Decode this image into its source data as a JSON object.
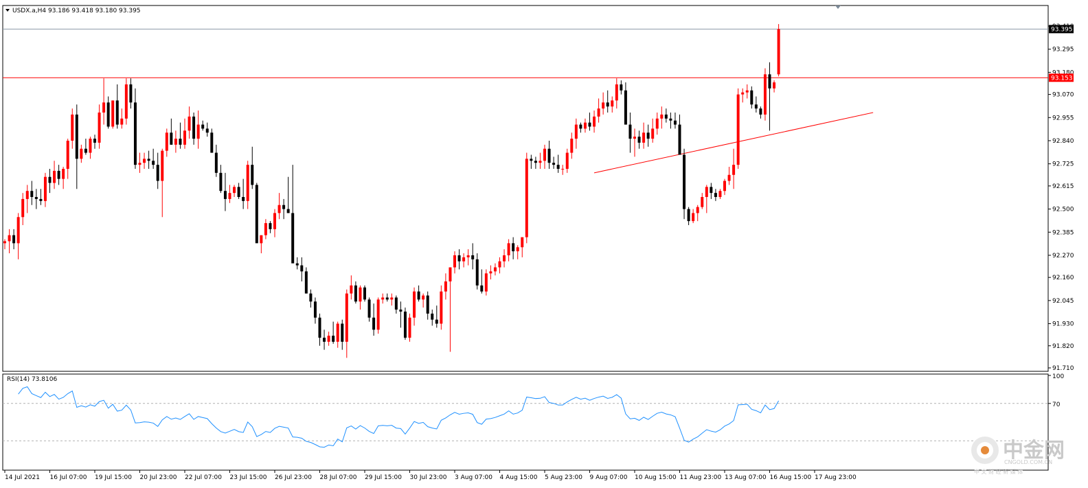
{
  "chart_header": {
    "symbol_line": "USDX.a,H4  93.186 93.418 93.180 93.395",
    "rsi_label": "RSI(14) 73.8106"
  },
  "watermark": {
    "brand": "中金网",
    "domain": "CNGOLD.COM.CN",
    "tagline": "中 文 财 经 新 媒 体"
  },
  "colors": {
    "bull": "#ff0000",
    "bear": "#000000",
    "rsi_line": "#1e90ff",
    "resistance": "#ff0000",
    "current_price_line": "#8c9aa8",
    "trendline": "#ff0000"
  },
  "chart_data": [
    {
      "type": "candlestick",
      "symbol": "USDX.a",
      "timeframe": "H4",
      "ohlc_header": {
        "open": 93.186,
        "high": 93.418,
        "low": 93.18,
        "close": 93.395
      },
      "ylim": [
        91.71,
        93.41
      ],
      "y_ticks": [
        "93.410",
        "93.295",
        "93.180",
        "93.070",
        "92.955",
        "92.840",
        "92.725",
        "92.615",
        "92.500",
        "92.385",
        "92.270",
        "92.160",
        "92.045",
        "91.930",
        "91.820",
        "91.710"
      ],
      "x_tick_labels": [
        "14 Jul 2021",
        "16 Jul 07:00",
        "19 Jul 15:00",
        "20 Jul 23:00",
        "22 Jul 07:00",
        "23 Jul 15:00",
        "26 Jul 23:00",
        "28 Jul 07:00",
        "29 Jul 15:00",
        "30 Jul 23:00",
        "3 Aug 07:00",
        "4 Aug 15:00",
        "5 Aug 23:00",
        "9 Aug 07:00",
        "10 Aug 15:00",
        "11 Aug 23:00",
        "13 Aug 07:00",
        "16 Aug 15:00",
        "17 Aug 23:00"
      ],
      "x_tick_index": [
        0,
        10,
        20,
        30,
        40,
        50,
        60,
        70,
        80,
        90,
        100,
        110,
        120,
        130,
        140,
        150,
        160,
        170,
        180
      ],
      "horizontal_lines": [
        {
          "price": 93.395,
          "label": "93.395",
          "role": "current"
        },
        {
          "price": 93.153,
          "label": "93.153",
          "role": "resistance"
        }
      ],
      "trendline": {
        "from": {
          "index": 131,
          "price": 92.68
        },
        "to": {
          "index": 193,
          "price": 92.98
        }
      },
      "candles": [
        [
          92.33,
          92.35,
          92.3,
          92.34
        ],
        [
          92.34,
          92.4,
          92.28,
          92.37
        ],
        [
          92.37,
          92.4,
          92.3,
          92.33
        ],
        [
          92.33,
          92.48,
          92.25,
          92.46
        ],
        [
          92.46,
          92.58,
          92.42,
          92.55
        ],
        [
          92.55,
          92.62,
          92.48,
          92.59
        ],
        [
          92.59,
          92.64,
          92.52,
          92.56
        ],
        [
          92.56,
          92.6,
          92.5,
          92.55
        ],
        [
          92.55,
          92.6,
          92.52,
          92.54
        ],
        [
          92.54,
          92.68,
          92.51,
          92.66
        ],
        [
          92.66,
          92.7,
          92.58,
          92.63
        ],
        [
          92.63,
          92.74,
          92.6,
          92.69
        ],
        [
          92.69,
          92.72,
          92.62,
          92.65
        ],
        [
          92.65,
          92.71,
          92.6,
          92.7
        ],
        [
          92.7,
          92.85,
          92.65,
          92.84
        ],
        [
          92.84,
          93.0,
          92.8,
          92.97
        ],
        [
          92.97,
          93.02,
          92.6,
          92.75
        ],
        [
          92.75,
          92.82,
          92.73,
          92.8
        ],
        [
          92.8,
          92.85,
          92.77,
          92.78
        ],
        [
          92.78,
          92.86,
          92.75,
          92.85
        ],
        [
          92.85,
          92.87,
          92.8,
          92.83
        ],
        [
          92.83,
          93.02,
          92.8,
          92.98
        ],
        [
          92.98,
          93.15,
          92.92,
          93.03
        ],
        [
          93.03,
          93.06,
          92.9,
          92.91
        ],
        [
          92.91,
          93.04,
          92.9,
          93.04
        ],
        [
          93.04,
          93.12,
          92.9,
          92.92
        ],
        [
          92.92,
          93.0,
          92.9,
          92.95
        ],
        [
          92.95,
          93.15,
          92.92,
          93.12
        ],
        [
          93.12,
          93.15,
          93.0,
          93.03
        ],
        [
          93.03,
          93.1,
          92.7,
          92.72
        ],
        [
          92.72,
          92.78,
          92.68,
          92.73
        ],
        [
          92.73,
          92.78,
          92.7,
          92.75
        ],
        [
          92.75,
          92.79,
          92.7,
          92.74
        ],
        [
          92.74,
          92.8,
          92.7,
          92.72
        ],
        [
          92.72,
          92.78,
          92.6,
          92.64
        ],
        [
          92.64,
          92.8,
          92.46,
          92.79
        ],
        [
          92.79,
          92.9,
          92.76,
          92.88
        ],
        [
          92.88,
          92.95,
          92.82,
          92.82
        ],
        [
          92.82,
          92.89,
          92.78,
          92.85
        ],
        [
          92.85,
          92.93,
          92.8,
          92.82
        ],
        [
          92.82,
          92.95,
          92.8,
          92.89
        ],
        [
          92.89,
          93.01,
          92.85,
          92.96
        ],
        [
          92.96,
          92.98,
          92.82,
          92.85
        ],
        [
          92.85,
          92.99,
          92.8,
          92.92
        ],
        [
          92.92,
          92.94,
          92.89,
          92.9
        ],
        [
          92.9,
          92.93,
          92.86,
          92.88
        ],
        [
          92.88,
          92.9,
          92.78,
          92.78
        ],
        [
          92.78,
          92.82,
          92.66,
          92.68
        ],
        [
          92.68,
          92.72,
          92.58,
          92.59
        ],
        [
          92.59,
          92.68,
          92.49,
          92.55
        ],
        [
          92.55,
          92.62,
          92.53,
          92.58
        ],
        [
          92.58,
          92.62,
          92.56,
          92.61
        ],
        [
          92.61,
          92.63,
          92.55,
          92.56
        ],
        [
          92.56,
          92.65,
          92.5,
          92.54
        ],
        [
          92.54,
          92.74,
          92.5,
          92.72
        ],
        [
          92.72,
          92.81,
          92.6,
          92.62
        ],
        [
          92.62,
          92.63,
          92.4,
          92.33
        ],
        [
          92.33,
          92.36,
          92.28,
          92.37
        ],
        [
          92.37,
          92.45,
          92.35,
          92.43
        ],
        [
          92.43,
          92.44,
          92.38,
          92.4
        ],
        [
          92.4,
          92.5,
          92.36,
          92.48
        ],
        [
          92.48,
          92.58,
          92.45,
          92.52
        ],
        [
          92.52,
          92.55,
          92.45,
          92.5
        ],
        [
          92.5,
          92.66,
          92.48,
          92.48
        ],
        [
          92.48,
          92.72,
          92.47,
          92.23
        ],
        [
          92.23,
          92.26,
          92.2,
          92.22
        ],
        [
          92.22,
          92.26,
          92.14,
          92.19
        ],
        [
          92.19,
          92.21,
          92.08,
          92.08
        ],
        [
          92.08,
          92.1,
          92.01,
          92.04
        ],
        [
          92.04,
          92.06,
          91.93,
          91.96
        ],
        [
          91.96,
          91.98,
          91.82,
          91.86
        ],
        [
          91.86,
          91.9,
          91.8,
          91.84
        ],
        [
          91.84,
          91.89,
          91.82,
          91.87
        ],
        [
          91.87,
          91.94,
          91.83,
          91.84
        ],
        [
          91.84,
          91.94,
          91.81,
          91.93
        ],
        [
          91.93,
          91.95,
          91.8,
          91.84
        ],
        [
          91.84,
          92.1,
          91.76,
          92.08
        ],
        [
          92.08,
          92.17,
          92.05,
          92.12
        ],
        [
          92.12,
          92.14,
          92.03,
          92.04
        ],
        [
          92.04,
          92.12,
          92.0,
          92.11
        ],
        [
          92.11,
          92.12,
          92.04,
          92.05
        ],
        [
          92.05,
          92.06,
          91.94,
          91.96
        ],
        [
          91.96,
          92.03,
          91.87,
          91.9
        ],
        [
          91.9,
          92.06,
          91.88,
          92.05
        ],
        [
          92.05,
          92.08,
          92.03,
          92.06
        ],
        [
          92.06,
          92.08,
          92.04,
          92.05
        ],
        [
          92.05,
          92.08,
          92.02,
          92.06
        ],
        [
          92.06,
          92.07,
          91.98,
          92.0
        ],
        [
          92.0,
          92.04,
          91.91,
          91.99
        ],
        [
          91.99,
          92.01,
          91.85,
          91.86
        ],
        [
          91.86,
          91.98,
          91.84,
          91.96
        ],
        [
          91.96,
          92.11,
          91.92,
          92.09
        ],
        [
          92.09,
          92.12,
          92.04,
          92.05
        ],
        [
          92.05,
          92.08,
          92.01,
          92.07
        ],
        [
          92.07,
          92.09,
          91.95,
          91.98
        ],
        [
          91.98,
          92.0,
          91.92,
          91.95
        ],
        [
          91.95,
          92.02,
          91.91,
          91.93
        ],
        [
          91.93,
          92.12,
          91.9,
          92.09
        ],
        [
          92.09,
          92.18,
          92.05,
          92.14
        ],
        [
          92.14,
          92.21,
          91.79,
          92.21
        ],
        [
          92.21,
          92.29,
          92.18,
          92.27
        ],
        [
          92.27,
          92.3,
          92.2,
          92.24
        ],
        [
          92.24,
          92.28,
          92.21,
          92.26
        ],
        [
          92.26,
          92.3,
          92.22,
          92.27
        ],
        [
          92.27,
          92.33,
          92.2,
          92.25
        ],
        [
          92.25,
          92.28,
          92.1,
          92.12
        ],
        [
          92.12,
          92.2,
          92.08,
          92.09
        ],
        [
          92.09,
          92.2,
          92.07,
          92.18
        ],
        [
          92.18,
          92.22,
          92.15,
          92.19
        ],
        [
          92.19,
          92.23,
          92.17,
          92.21
        ],
        [
          92.21,
          92.26,
          92.18,
          92.24
        ],
        [
          92.24,
          92.3,
          92.21,
          92.27
        ],
        [
          92.27,
          92.35,
          92.24,
          92.33
        ],
        [
          92.33,
          92.36,
          92.25,
          92.29
        ],
        [
          92.29,
          92.32,
          92.25,
          92.31
        ],
        [
          92.31,
          92.34,
          92.26,
          92.36
        ],
        [
          92.36,
          92.78,
          92.33,
          92.75
        ],
        [
          92.75,
          92.77,
          92.7,
          92.74
        ],
        [
          92.74,
          92.76,
          92.7,
          92.73
        ],
        [
          92.73,
          92.78,
          92.7,
          92.74
        ],
        [
          92.74,
          92.82,
          92.7,
          92.8
        ],
        [
          92.8,
          92.84,
          92.7,
          92.73
        ],
        [
          92.73,
          92.76,
          92.7,
          92.72
        ],
        [
          92.72,
          92.77,
          92.68,
          92.7
        ],
        [
          92.7,
          92.72,
          92.67,
          92.7
        ],
        [
          92.7,
          92.8,
          92.68,
          92.78
        ],
        [
          92.78,
          92.88,
          92.75,
          92.85
        ],
        [
          92.85,
          92.95,
          92.8,
          92.92
        ],
        [
          92.92,
          92.93,
          92.88,
          92.9
        ],
        [
          92.9,
          92.95,
          92.88,
          92.93
        ],
        [
          92.93,
          92.98,
          92.89,
          92.91
        ],
        [
          92.91,
          92.99,
          92.88,
          92.96
        ],
        [
          92.96,
          93.05,
          92.93,
          93.0
        ],
        [
          93.0,
          93.08,
          92.97,
          93.03
        ],
        [
          93.03,
          93.09,
          92.98,
          93.01
        ],
        [
          93.01,
          93.06,
          92.98,
          93.04
        ],
        [
          93.04,
          93.15,
          93.0,
          93.12
        ],
        [
          93.12,
          93.14,
          93.07,
          93.09
        ],
        [
          93.09,
          93.13,
          92.95,
          92.92
        ],
        [
          92.92,
          92.98,
          92.78,
          92.85
        ],
        [
          92.85,
          92.9,
          92.76,
          92.86
        ],
        [
          92.86,
          92.89,
          92.8,
          92.83
        ],
        [
          92.83,
          92.93,
          92.8,
          92.88
        ],
        [
          92.88,
          92.92,
          92.81,
          92.85
        ],
        [
          92.85,
          92.95,
          92.83,
          92.9
        ],
        [
          92.9,
          92.98,
          92.87,
          92.95
        ],
        [
          92.95,
          93.01,
          92.9,
          92.97
        ],
        [
          92.97,
          93.0,
          92.93,
          92.95
        ],
        [
          92.95,
          92.98,
          92.9,
          92.94
        ],
        [
          92.94,
          92.98,
          92.9,
          92.92
        ],
        [
          92.92,
          92.97,
          92.8,
          92.77
        ],
        [
          92.77,
          92.8,
          92.45,
          92.5
        ],
        [
          92.5,
          92.51,
          92.42,
          92.44
        ],
        [
          92.44,
          92.5,
          92.43,
          92.48
        ],
        [
          92.48,
          92.52,
          92.44,
          92.51
        ],
        [
          92.51,
          92.58,
          92.5,
          92.56
        ],
        [
          92.56,
          92.62,
          92.48,
          92.61
        ],
        [
          92.61,
          92.63,
          92.55,
          92.58
        ],
        [
          92.58,
          92.6,
          92.54,
          92.56
        ],
        [
          92.56,
          92.6,
          92.55,
          92.59
        ],
        [
          92.59,
          92.65,
          92.57,
          92.64
        ],
        [
          92.64,
          92.71,
          92.62,
          92.67
        ],
        [
          92.67,
          92.8,
          92.6,
          92.72
        ],
        [
          92.72,
          93.1,
          92.7,
          93.07
        ],
        [
          93.07,
          93.1,
          93.03,
          93.08
        ],
        [
          93.08,
          93.12,
          93.05,
          93.09
        ],
        [
          93.09,
          93.11,
          93.0,
          93.02
        ],
        [
          93.02,
          93.06,
          92.98,
          93.0
        ],
        [
          93.0,
          93.01,
          92.95,
          92.97
        ],
        [
          92.97,
          93.2,
          92.94,
          93.17
        ],
        [
          93.17,
          93.23,
          92.89,
          93.1
        ],
        [
          93.1,
          93.14,
          93.08,
          93.13
        ],
        [
          93.17,
          93.42,
          93.16,
          93.395
        ]
      ]
    },
    {
      "type": "line",
      "name": "RSI(14)",
      "last_value": 73.8106,
      "ylim": [
        0,
        100
      ],
      "y_ticks": [
        "100",
        "70"
      ],
      "levels": [
        70,
        30
      ],
      "values_from_close": true
    }
  ]
}
